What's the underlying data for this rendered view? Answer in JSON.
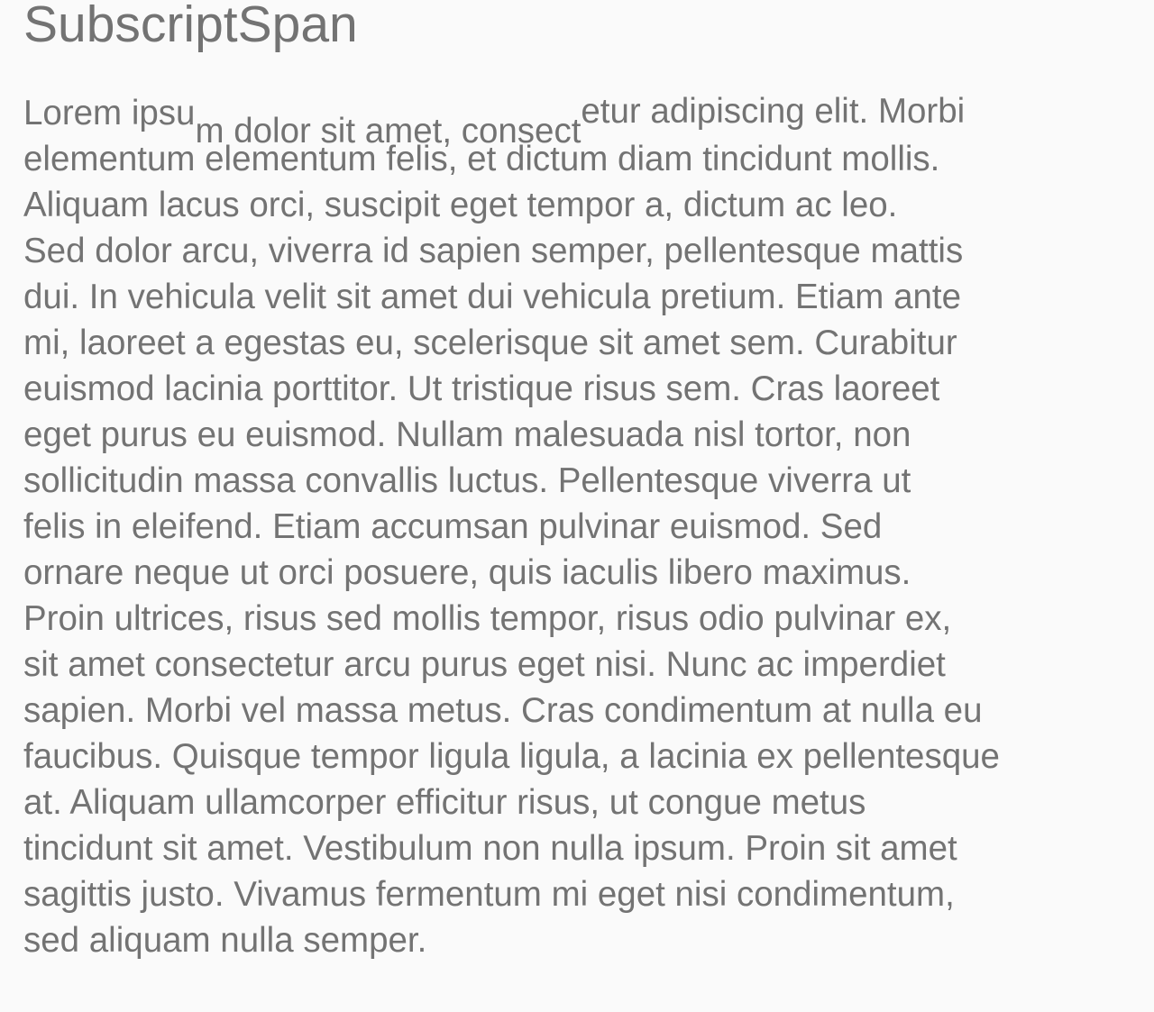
{
  "title": "SubscriptSpan",
  "paragraph": {
    "first_line": {
      "normal_1": "Lorem ipsu",
      "subscript": "m dolor sit amet, consect",
      "superscript": "etur adipiscing elit. Morbi"
    },
    "lines": [
      "elementum elementum felis, et dictum diam tincidunt mollis.",
      "Aliquam lacus orci, suscipit eget tempor a, dictum ac leo.",
      "Sed dolor arcu, viverra id sapien semper, pellentesque mattis",
      "dui. In vehicula velit sit amet dui vehicula pretium. Etiam ante",
      "mi, laoreet a egestas eu, scelerisque sit amet sem. Curabitur",
      "euismod lacinia porttitor. Ut tristique risus sem. Cras laoreet",
      "eget purus eu euismod. Nullam malesuada nisl tortor, non",
      "sollicitudin massa convallis luctus. Pellentesque viverra ut",
      "felis in eleifend. Etiam accumsan pulvinar euismod. Sed",
      "ornare neque ut orci posuere, quis iaculis libero maximus.",
      "Proin ultrices, risus sed mollis tempor, risus odio pulvinar ex,",
      "sit amet consectetur arcu purus eget nisi. Nunc ac imperdiet",
      "sapien. Morbi vel massa metus. Cras condimentum at nulla eu",
      "faucibus. Quisque tempor ligula ligula, a lacinia ex pellentesque",
      "at. Aliquam ullamcorper efficitur risus, ut congue metus",
      "tincidunt sit amet. Vestibulum non nulla ipsum. Proin sit amet",
      "sagittis justo. Vivamus fermentum mi eget nisi condimentum,",
      "sed aliquam nulla semper."
    ]
  },
  "colors": {
    "background": "#fafafa",
    "text": "#737373"
  }
}
